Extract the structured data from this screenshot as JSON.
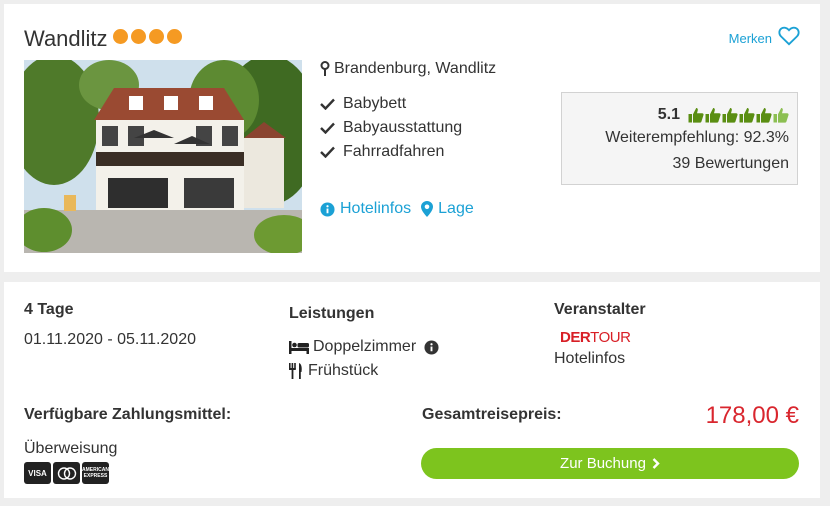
{
  "hotel": {
    "name": "Wandlitz",
    "stars": 4,
    "star_color": "#f59a23",
    "location": "Brandenburg, Wandlitz",
    "features": [
      "Babybett",
      "Babyausstattung",
      "Fahrradfahren"
    ],
    "links": {
      "hotelinfos": "Hotelinfos",
      "lage": "Lage"
    },
    "merken_label": "Merken"
  },
  "rating": {
    "score": "5.1",
    "thumbs_total": 6,
    "thumbs_filled": 5,
    "recommendation": "Weiterempfehlung: 92.3%",
    "reviews": "39 Bewertungen"
  },
  "trip": {
    "duration": "4 Tage",
    "dates": "01.11.2020 - 05.11.2020"
  },
  "services": {
    "heading": "Leistungen",
    "room": "Doppelzimmer",
    "board": "Frühstück"
  },
  "operator": {
    "heading": "Veranstalter",
    "logo_text_bold": "DER",
    "logo_text_thin": "TOUR",
    "link": "Hotelinfos"
  },
  "payment": {
    "heading": "Verfügbare Zahlungsmittel:",
    "method": "Überweisung",
    "logos": [
      "VISA",
      "Mastercard",
      "American Express"
    ]
  },
  "price": {
    "heading": "Gesamtreisepreis:",
    "amount": "178,00 €",
    "button": "Zur Buchung"
  },
  "colors": {
    "accent": "#1ba1d5",
    "price": "#d9262e",
    "button": "#7dc41e",
    "thumb_green": "#5a8e12"
  }
}
